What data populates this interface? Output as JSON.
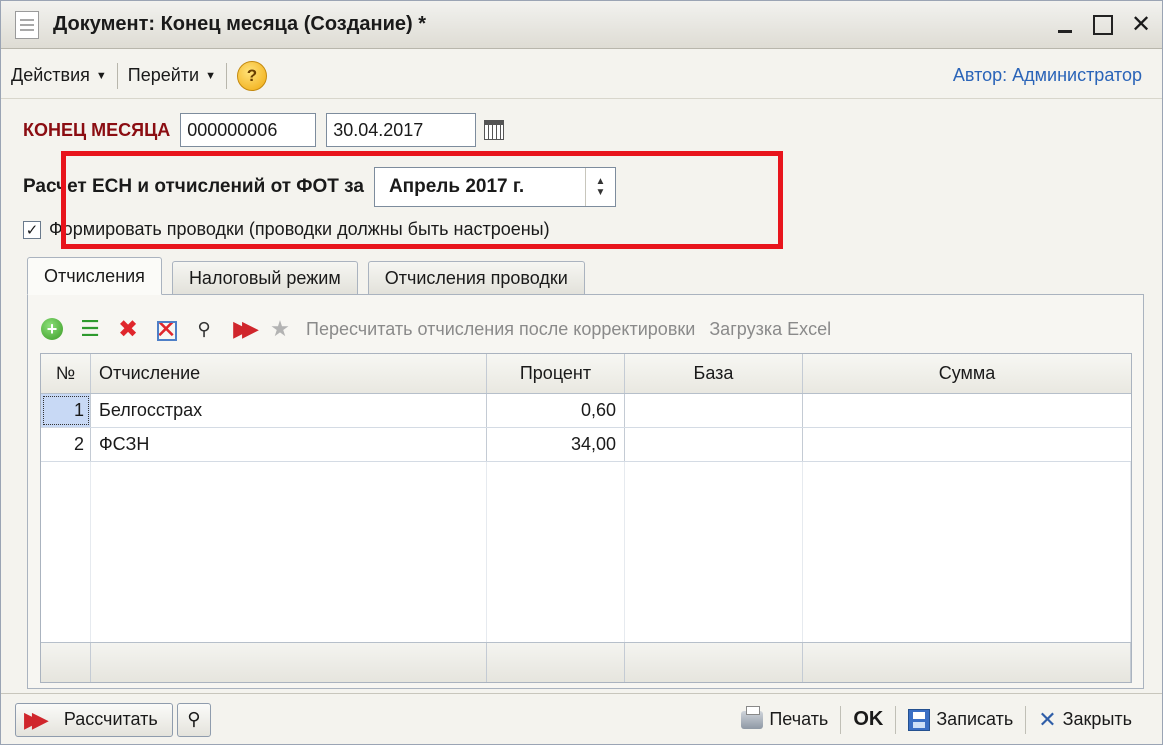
{
  "window": {
    "title": "Документ: Конец месяца (Создание) *",
    "minimize": "_",
    "maximize": "",
    "close": "✕"
  },
  "menu": {
    "actions": "Действия",
    "goto": "Перейти",
    "help": "?",
    "author": "Автор: Администратор"
  },
  "header": {
    "doc_label": "КОНЕЦ МЕСЯЦА",
    "number": "000000006",
    "date": "30.04.2017"
  },
  "esn": {
    "label": "Расчет ЕСН и отчислений от ФОТ за",
    "period": "Апрель 2017 г."
  },
  "posting": {
    "checked": true,
    "label": "Формировать проводки (проводки должны быть настроены)"
  },
  "tabs": [
    {
      "label": "Отчисления",
      "active": true
    },
    {
      "label": "Налоговый режим",
      "active": false
    },
    {
      "label": "Отчисления проводки",
      "active": false
    }
  ],
  "toolbar": {
    "recalc": "Пересчитать отчисления после корректировки",
    "excel": "Загрузка Excel"
  },
  "table": {
    "columns": [
      "№",
      "Отчисление",
      "Процент",
      "База",
      "Сумма"
    ],
    "rows": [
      {
        "no": "1",
        "name": "Белгосстрах",
        "percent": "0,60",
        "base": "",
        "sum": ""
      },
      {
        "no": "2",
        "name": "ФСЗН",
        "percent": "34,00",
        "base": "",
        "sum": ""
      }
    ]
  },
  "bottom": {
    "calculate": "Рассчитать",
    "print": "Печать",
    "ok": "OK",
    "save": "Записать",
    "close": "Закрыть"
  },
  "colors": {
    "highlight": "#e8141c",
    "doc_label": "#8b0d12",
    "author_link": "#2a64b8"
  }
}
